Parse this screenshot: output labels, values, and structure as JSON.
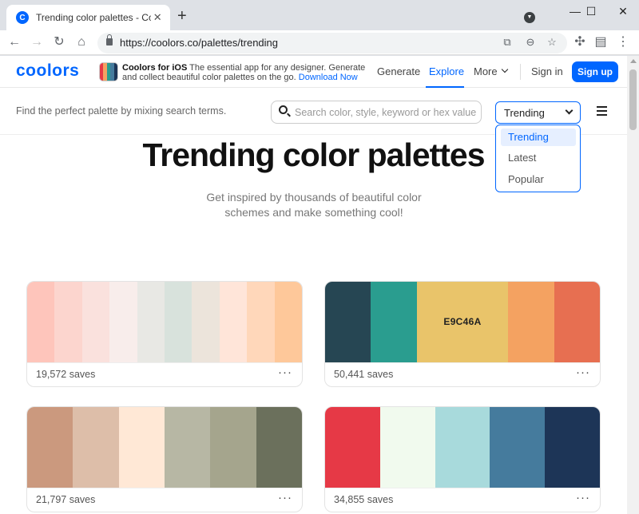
{
  "browser": {
    "tab_title": "Trending color palettes - Coolors",
    "tab_favicon": "C",
    "close_glyph": "✕",
    "newtab_glyph": "+",
    "url": "https://coolors.co/palettes/trending",
    "window_controls": [
      "—",
      "☐",
      "✕"
    ],
    "nav_glyphs": {
      "back": "←",
      "forward": "→",
      "reload": "↻",
      "home": "⌂"
    },
    "omni_glyphs": {
      "translate": "⧉",
      "zoom": "⊖",
      "star": "☆"
    },
    "ext_glyphs": {
      "puzzle": "✣",
      "profile": "▤",
      "menu": "⋮"
    }
  },
  "site": {
    "logo": "coolors",
    "promo": {
      "title": "Coolors for iOS",
      "line1_rest": "The essential app for any designer. Generate",
      "line2": "and collect beautiful color palettes on the go.",
      "link": "Download Now"
    },
    "nav": [
      "Generate",
      "Explore",
      "More"
    ],
    "nav_active": "Explore",
    "sign_in": "Sign in",
    "sign_up": "Sign up"
  },
  "search": {
    "hint": "Find the perfect palette by mixing search terms.",
    "placeholder": "Search color, style, keyword or hex value",
    "sort_value": "Trending",
    "sort_options": [
      "Trending",
      "Latest",
      "Popular"
    ],
    "sort_selected": "Trending"
  },
  "hero": {
    "title": "Trending color palettes",
    "subtitle_line1": "Get inspired by thousands of beautiful color",
    "subtitle_line2": "schemes and make something cool!"
  },
  "palettes": [
    {
      "saves": "19,572 saves",
      "colors": [
        "#FEC5BB",
        "#FCD5CE",
        "#FAE1DD",
        "#F8EDEB",
        "#E8E8E4",
        "#D8E2DC",
        "#ECE4DB",
        "#FFE5D9",
        "#FFD7BA",
        "#FEC89A"
      ]
    },
    {
      "saves": "50,441 saves",
      "colors": [
        "#264653",
        "#2A9D8F",
        "#E9C46A",
        "#F4A261",
        "#E76F51"
      ],
      "hovered_label": "E9C46A"
    },
    {
      "saves": "21,797 saves",
      "colors": [
        "#CB997E",
        "#DDBEA9",
        "#FFE8D6",
        "#B7B7A4",
        "#A5A58D",
        "#6B705C"
      ]
    },
    {
      "saves": "34,855 saves",
      "colors": [
        "#E63946",
        "#F1FAEE",
        "#A8DADC",
        "#457B9D",
        "#1D3557"
      ]
    }
  ],
  "more_glyph": "···"
}
